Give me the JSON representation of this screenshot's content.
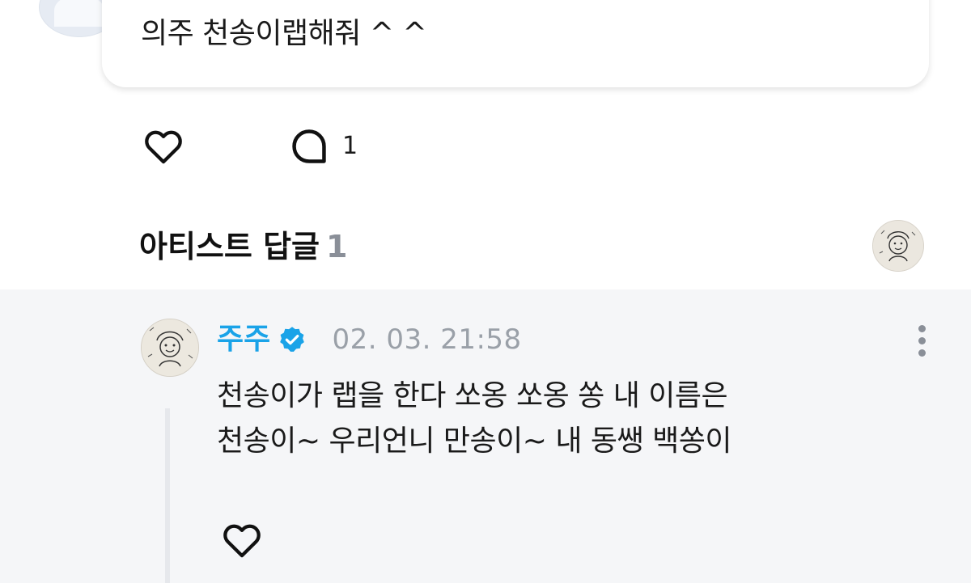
{
  "post": {
    "comment_text": "의주 천송이랩해줘 ^ ^",
    "comment_count": "1"
  },
  "artist_replies": {
    "title": "아티스트 답글",
    "count": "1"
  },
  "reply": {
    "author": "주주",
    "timestamp": "02. 03. 21:58",
    "lines": [
      "천송이가 랩을 한다 쏘옹 쏘옹 쏭 내 이름은",
      "천송이~ 우리언니 만송이~ 내 동쌩 백쏭이"
    ]
  },
  "colors": {
    "author_name": "#1aa3e8",
    "verified_badge": "#1aa3e8",
    "timestamp": "#9aa0a8",
    "reply_background": "#f5f6f8"
  },
  "icons": {
    "like": "heart-outline-icon",
    "comment": "speech-bubble-icon",
    "verified": "verified-badge-icon",
    "more": "more-vertical-icon"
  }
}
